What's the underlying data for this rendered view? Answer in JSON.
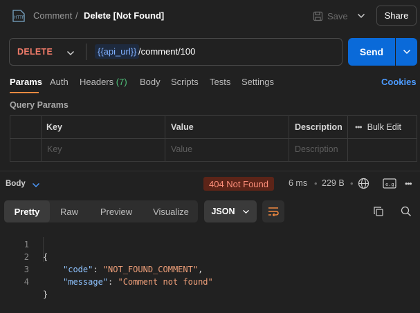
{
  "header": {
    "icon": "http-icon",
    "breadcrumb_parent": "Comment",
    "breadcrumb_sep": "/",
    "breadcrumb_current": "Delete [Not Found]",
    "save_label": "Save",
    "share_label": "Share"
  },
  "request": {
    "method": "DELETE",
    "url_variable": "{{api_url}}",
    "url_path": "/comment/100",
    "send_label": "Send"
  },
  "tabs": [
    {
      "label": "Params",
      "active": true
    },
    {
      "label": "Auth"
    },
    {
      "label": "Headers",
      "count": "(7)"
    },
    {
      "label": "Body"
    },
    {
      "label": "Scripts"
    },
    {
      "label": "Tests"
    },
    {
      "label": "Settings"
    }
  ],
  "cookies_label": "Cookies",
  "query_params": {
    "title": "Query Params",
    "columns": [
      "Key",
      "Value",
      "Description"
    ],
    "bulk_edit": "Bulk Edit",
    "placeholders": {
      "key": "Key",
      "value": "Value",
      "description": "Description"
    }
  },
  "response": {
    "body_label": "Body",
    "status": "404 Not Found",
    "time": "6 ms",
    "size": "229 B",
    "tabs": [
      "Pretty",
      "Raw",
      "Preview",
      "Visualize"
    ],
    "active_tab": "Pretty",
    "format": "JSON",
    "lines": [
      {
        "n": "1",
        "text": "{"
      },
      {
        "n": "2",
        "key": "\"code\"",
        "value": "\"NOT_FOUND_COMMENT\"",
        "trail": ","
      },
      {
        "n": "3",
        "key": "\"message\"",
        "value": "\"Comment not found\"",
        "trail": ""
      },
      {
        "n": "4",
        "text": "}"
      }
    ]
  },
  "colors": {
    "accent": "#0a6ad9",
    "method_delete": "#f27c6a",
    "tab_active_underline": "#f28a40",
    "status_error_bg": "#5c2418",
    "status_error_text": "#ff8f7a",
    "link": "#4c9bff"
  }
}
